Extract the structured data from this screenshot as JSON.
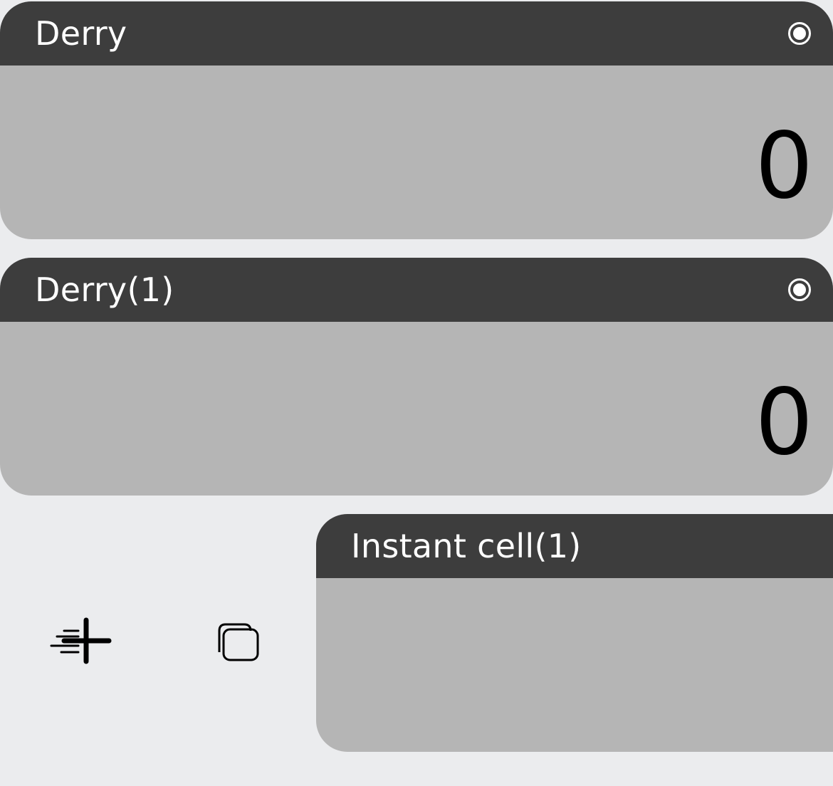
{
  "counters": [
    {
      "title": "Derry",
      "value": "0",
      "selected": true
    },
    {
      "title": "Derry(1)",
      "value": "0",
      "selected": true
    }
  ],
  "instant_cell": {
    "title": "Instant cell(1)"
  },
  "toolbar": {
    "quick_add_icon": "quick-add-icon",
    "duplicate_icon": "duplicate-icon"
  },
  "colors": {
    "background": "#ebecee",
    "header": "#3d3d3d",
    "card_body": "#b5b5b5",
    "title_text": "#ffffff",
    "value_text": "#000000"
  }
}
